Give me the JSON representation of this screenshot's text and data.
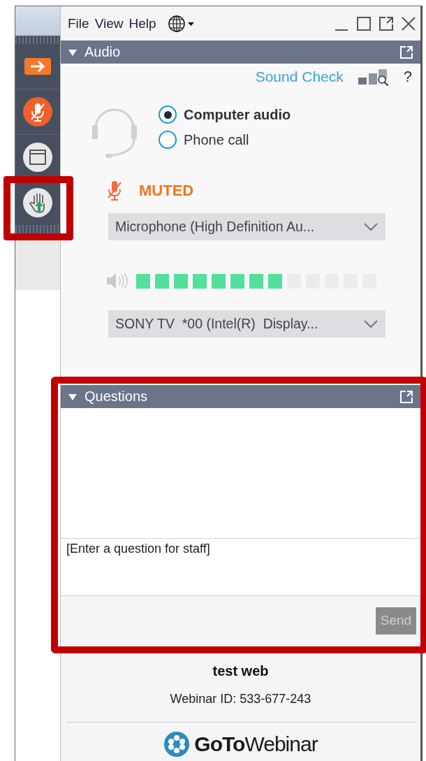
{
  "menu": [
    {
      "label": "File"
    },
    {
      "label": "View"
    },
    {
      "label": "Help"
    }
  ],
  "sidebar": {
    "items": [
      {
        "kind": "arrow",
        "highlighted": false
      },
      {
        "kind": "mic",
        "highlighted": false
      },
      {
        "kind": "window",
        "highlighted": false
      },
      {
        "kind": "hand",
        "highlighted": true
      }
    ]
  },
  "audio": {
    "title": "Audio",
    "expanded": true,
    "sound_check": "Sound Check",
    "help": "?",
    "modes": [
      {
        "label": "Computer audio",
        "selected": true
      },
      {
        "label": "Phone call",
        "selected": false
      }
    ],
    "status": "MUTED",
    "microphone": "Microphone (High Definition Au...",
    "meter": {
      "level": 0.615
    },
    "speaker": "SONY TV  *00 (Intel(R)  Display..."
  },
  "questions": {
    "title": "Questions",
    "expanded": true,
    "highlighted": true,
    "placeholder": "[Enter a question for staff]",
    "send": "Send",
    "send_disabled": true
  },
  "footer": {
    "title": "test web",
    "webinar_id": "Webinar ID: 533-677-243",
    "logo_bold": "GoTo",
    "logo_rest": "Webinar"
  }
}
